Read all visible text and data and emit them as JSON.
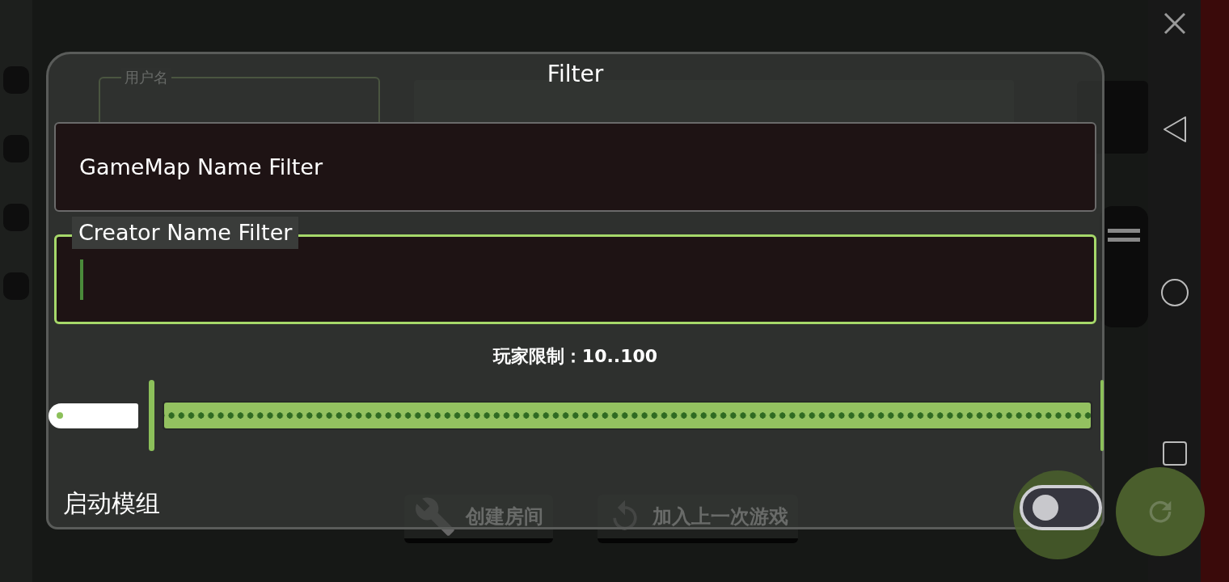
{
  "background": {
    "username_label": "用户名",
    "buttons": [
      {
        "label": "创建房间",
        "kind": "wrench"
      },
      {
        "label": "加入上一次游戏",
        "kind": "undo"
      }
    ]
  },
  "dialog": {
    "title": "Filter",
    "fields": [
      {
        "placeholder": "GameMap Name Filter",
        "focused": false
      },
      {
        "label": "Creator Name Filter",
        "focused": true
      }
    ],
    "player_limit": {
      "label": "玩家限制：10..100",
      "level": 1
    },
    "mods": {
      "label": "启动模组",
      "on": false
    }
  }
}
